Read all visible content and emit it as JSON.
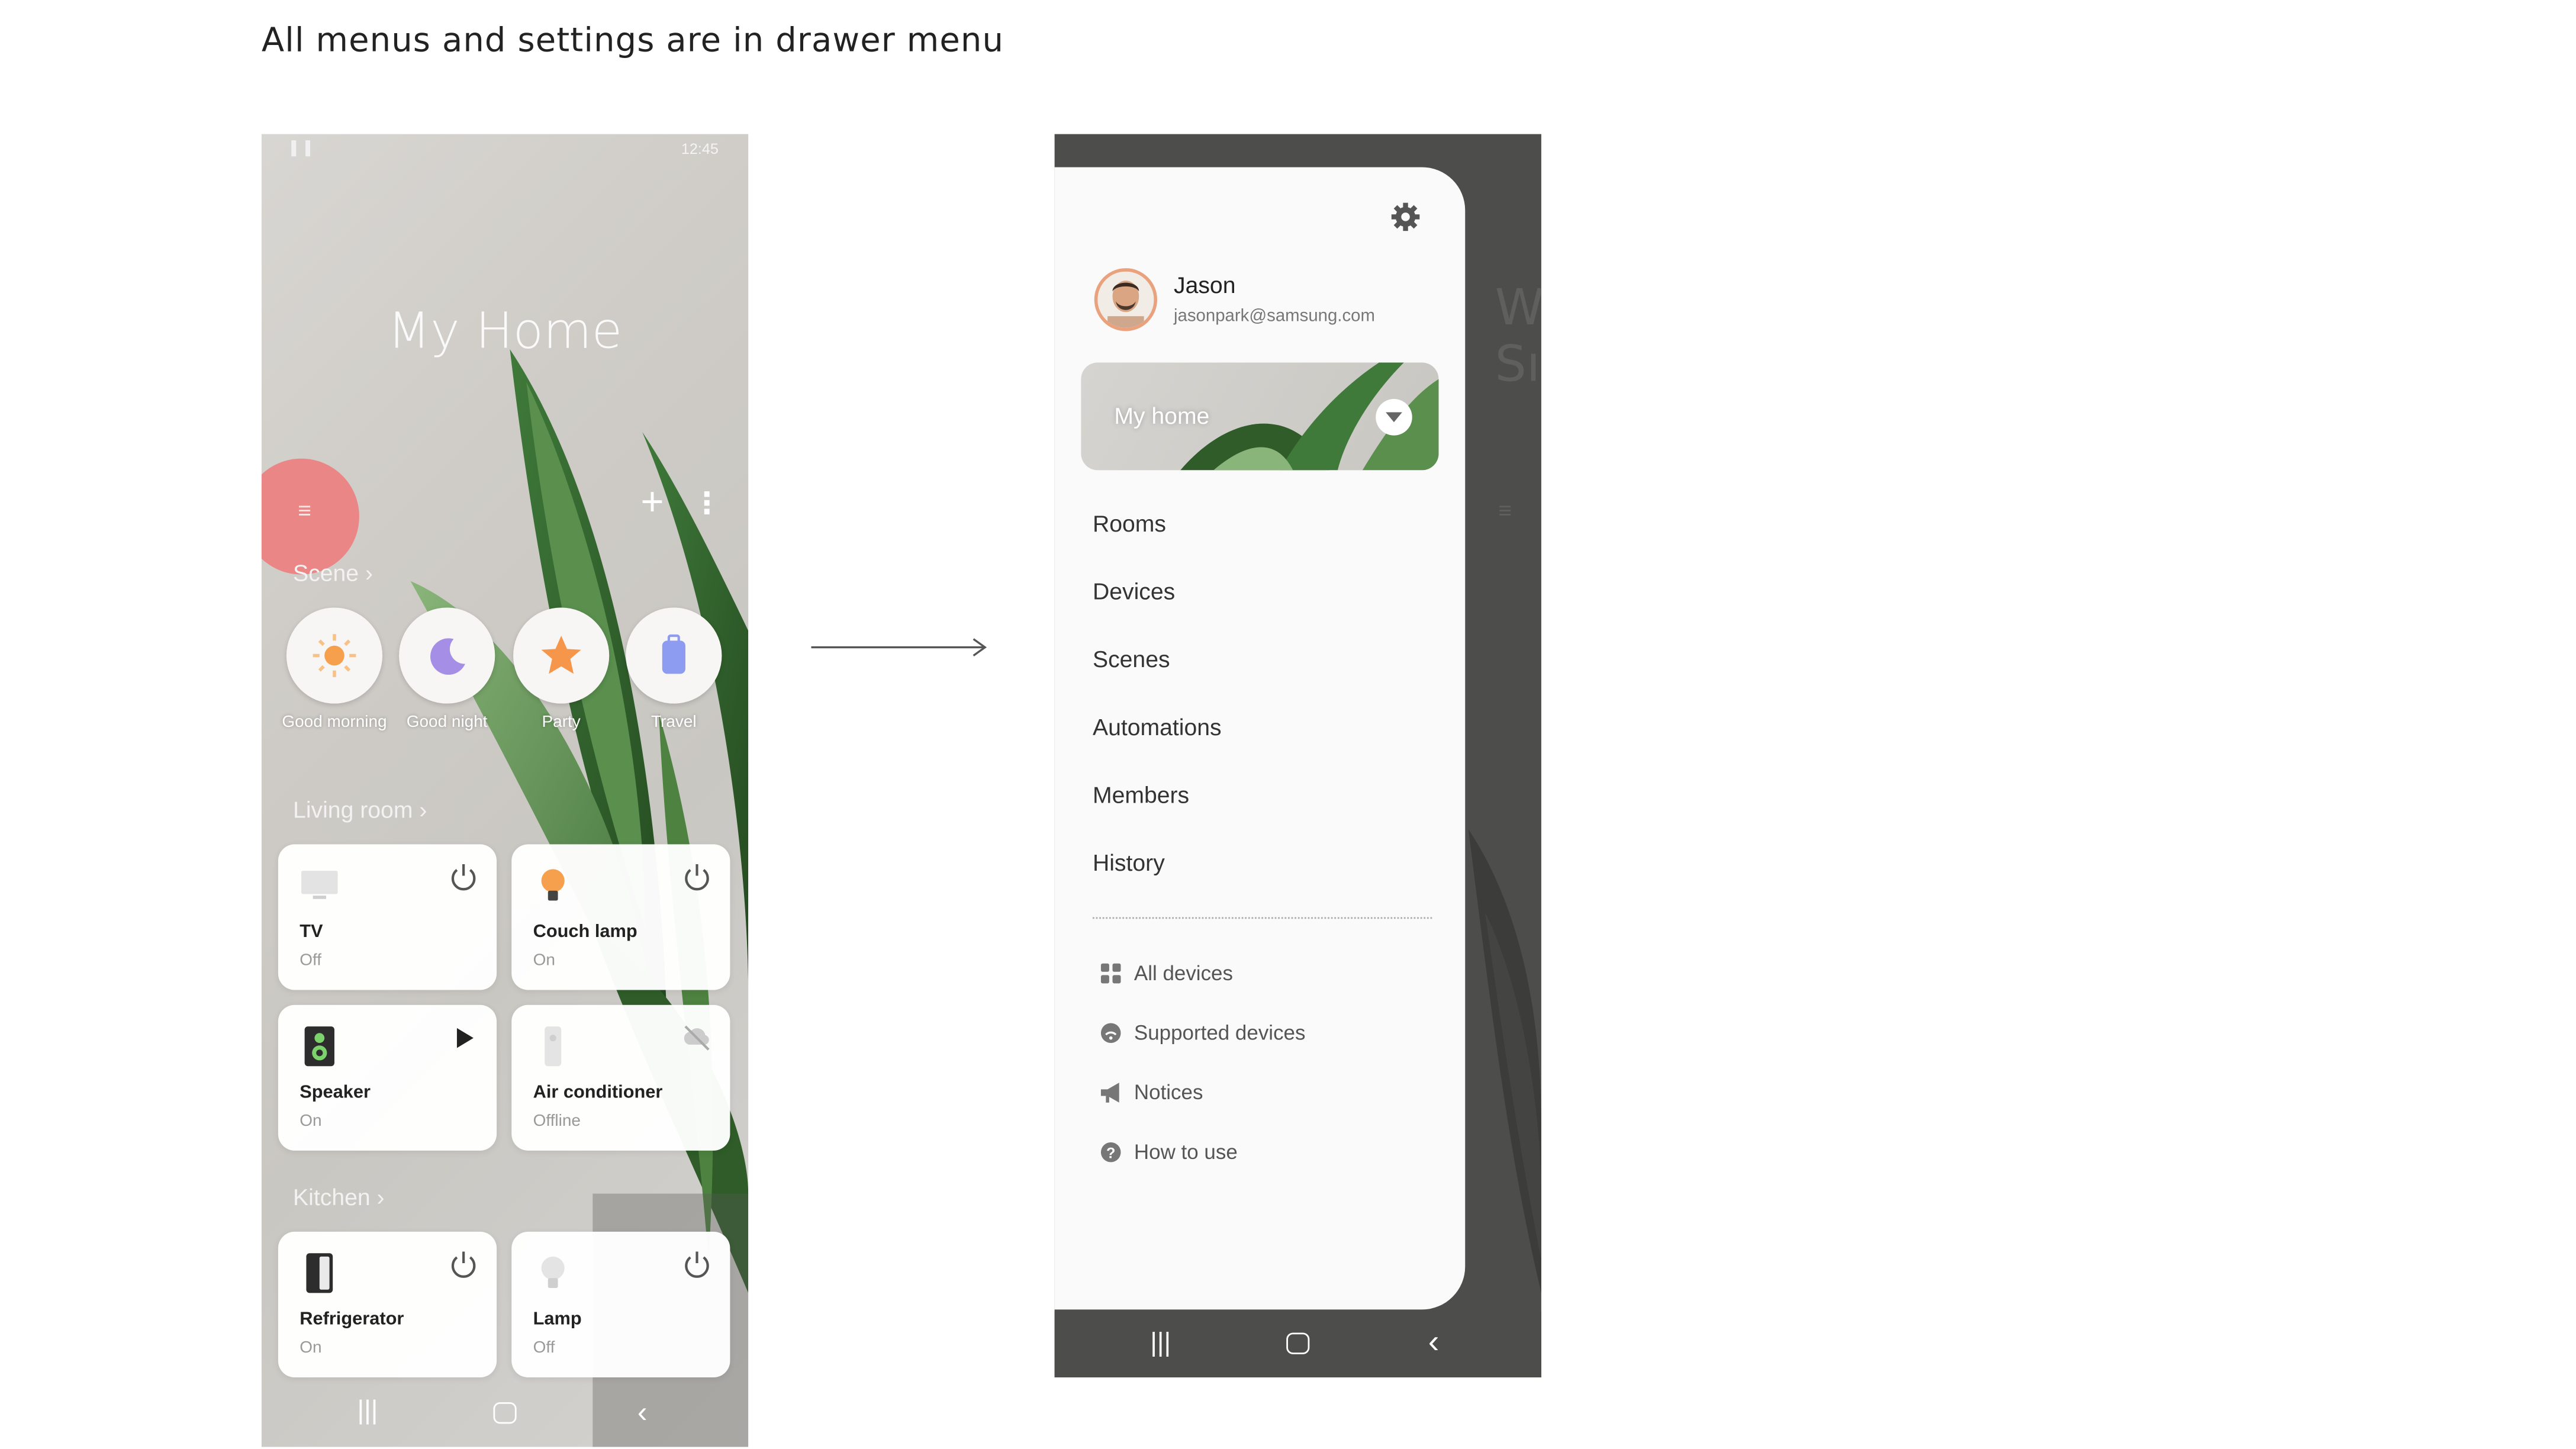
{
  "caption": "All menus and settings are in drawer menu",
  "phone_home": {
    "status_time": "12:45",
    "title": "My Home",
    "actions": {
      "add_icon": "plus-icon",
      "more_icon": "kebab-icon",
      "menu_icon": "hamburger-icon"
    },
    "scene_header": "Scene",
    "scenes": [
      {
        "label": "Good morning",
        "icon": "sun-icon",
        "color": "#f6a04d"
      },
      {
        "label": "Good night",
        "icon": "moon-icon",
        "color": "#a48ee6"
      },
      {
        "label": "Party",
        "icon": "star-icon",
        "color": "#f5964a"
      },
      {
        "label": "Travel",
        "icon": "luggage-icon",
        "color": "#8d9bf0"
      }
    ],
    "rooms": [
      {
        "name": "Living room",
        "devices": [
          {
            "name": "TV",
            "status": "Off",
            "icon": "tv-icon",
            "action": "power-icon"
          },
          {
            "name": "Couch lamp",
            "status": "On",
            "icon": "lamp-icon",
            "action": "power-icon"
          },
          {
            "name": "Speaker",
            "status": "On",
            "icon": "speaker-icon",
            "action": "play-icon"
          },
          {
            "name": "Air conditioner",
            "status": "Offline",
            "icon": "air-conditioner-icon",
            "action": "cloud-off-icon"
          }
        ]
      },
      {
        "name": "Kitchen",
        "devices": [
          {
            "name": "Refrigerator",
            "status": "On",
            "icon": "refrigerator-icon",
            "action": "power-icon"
          },
          {
            "name": "Lamp",
            "status": "Off",
            "icon": "bulb-icon",
            "action": "power-icon"
          }
        ]
      }
    ]
  },
  "phone_drawer": {
    "settings_icon": "gear-icon",
    "user": {
      "name": "Jason",
      "email": "jasonpark@samsung.com"
    },
    "home_selector": "My home",
    "menu": [
      "Rooms",
      "Devices",
      "Scenes",
      "Automations",
      "Members",
      "History"
    ],
    "sub_menu": [
      {
        "label": "All devices",
        "icon": "grid-icon"
      },
      {
        "label": "Supported devices",
        "icon": "wifi-icon"
      },
      {
        "label": "Notices",
        "icon": "megaphone-icon"
      },
      {
        "label": "How to use",
        "icon": "help-icon"
      }
    ],
    "background_text": [
      "W",
      "Sı"
    ]
  }
}
